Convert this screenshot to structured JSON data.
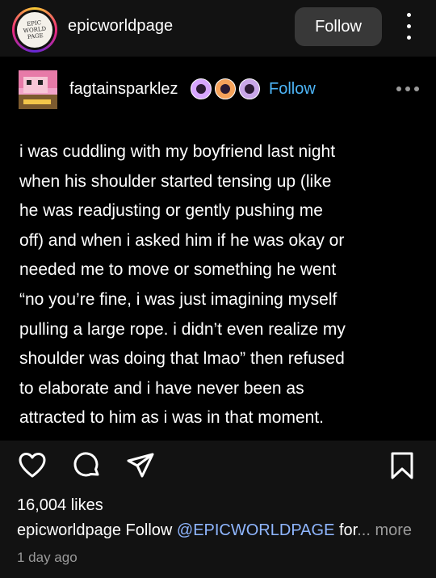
{
  "header": {
    "avatar_text": "EPIC WORLD PAGE",
    "account_name": "epicworldpage",
    "follow_label": "Follow"
  },
  "post_card": {
    "username": "fagtainsparklez",
    "follow_label": "Follow",
    "lines": [
      "i was cuddling with my boyfriend last night",
      "when his shoulder started tensing up (like",
      "he was readjusting or gently pushing me",
      "off) and when i asked him if he was okay or",
      "needed me to move or something he went",
      "“no you’re fine, i was just imagining myself",
      "pulling a large rope. i didn’t even realize my",
      "shoulder was doing that lmao” then refused",
      "to elaborate and i have never been as",
      "attracted to him as i was in that moment."
    ]
  },
  "footer": {
    "likes": "16,004 likes",
    "caption_user": "epicworldpage",
    "caption_text": " Follow ",
    "caption_mention": "@EPICWORLDPAGE",
    "caption_tail": " for",
    "caption_more": "... more",
    "timestamp": "1 day ago"
  },
  "colors": {
    "background": "#121212",
    "card_background": "#000000",
    "follow_blue": "#4db5f7",
    "mention_blue": "#8fb6ff",
    "muted": "#9a9a9a"
  },
  "icons": [
    "kebab-menu-icon",
    "heart-icon",
    "comment-icon",
    "share-icon",
    "bookmark-icon",
    "more-dots-icon"
  ]
}
